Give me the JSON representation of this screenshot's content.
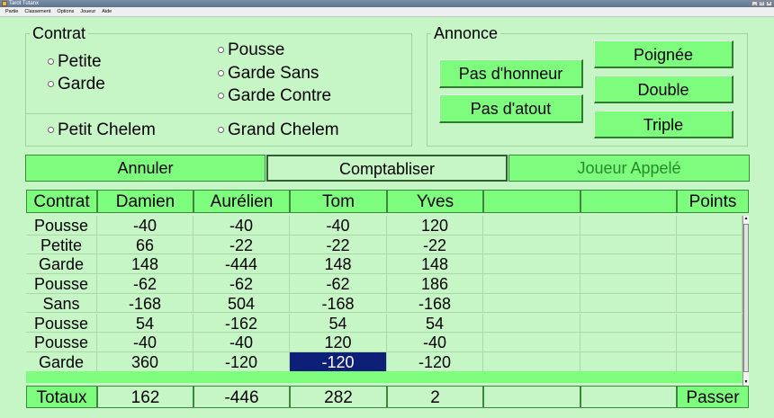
{
  "window": {
    "title": "Tarot Tutanx"
  },
  "menu": [
    "Partie",
    "Classement",
    "Options",
    "Joueur",
    "Aide"
  ],
  "contrat": {
    "legend": "Contrat",
    "options": [
      "Petite",
      "Garde",
      "Pousse",
      "Garde Sans",
      "Garde Contre"
    ],
    "chelem": [
      "Petit Chelem",
      "Grand Chelem"
    ]
  },
  "annonce": {
    "legend": "Annonce",
    "buttons": [
      "Pas d'honneur",
      "Pas d'atout",
      "Poignée",
      "Double",
      "Triple"
    ]
  },
  "actions": {
    "annuler": "Annuler",
    "comptabliser": "Comptabliser",
    "joueur_appele": "Joueur Appelé"
  },
  "table": {
    "headers": [
      "Contrat",
      "Damien",
      "Aurélien",
      "Tom",
      "Yves",
      "",
      "",
      "Points"
    ],
    "rows": [
      [
        "Pousse",
        "-40",
        "-40",
        "-40",
        "120"
      ],
      [
        "Petite",
        "66",
        "-22",
        "-22",
        "-22"
      ],
      [
        "Garde",
        "148",
        "-444",
        "148",
        "148"
      ],
      [
        "Pousse",
        "-62",
        "-62",
        "-62",
        "186"
      ],
      [
        "Sans",
        "-168",
        "504",
        "-168",
        "-168"
      ],
      [
        "Pousse",
        "54",
        "-162",
        "54",
        "54"
      ],
      [
        "Pousse",
        "-40",
        "-40",
        "120",
        "-40"
      ],
      [
        "Garde",
        "360",
        "-120",
        "-120",
        "-120"
      ]
    ],
    "selected": {
      "row": 7,
      "col": 3
    }
  },
  "totaux": {
    "label": "Totaux",
    "values": [
      "162",
      "-446",
      "282",
      "2"
    ],
    "passer": "Passer"
  }
}
